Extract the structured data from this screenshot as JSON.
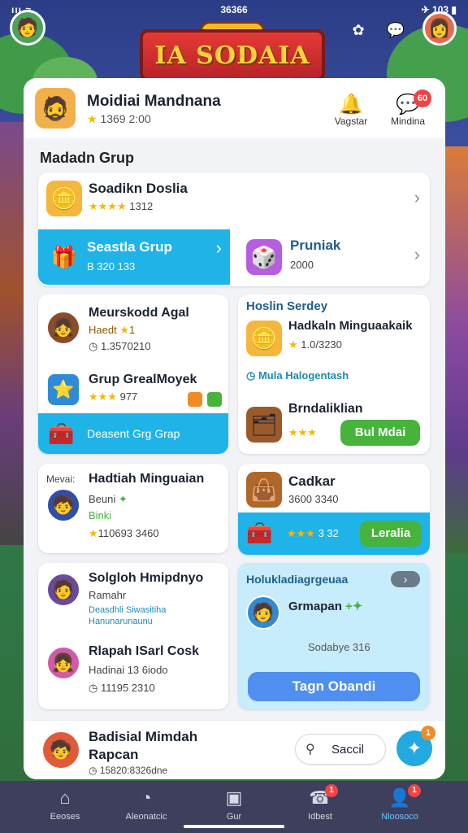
{
  "status": {
    "time": "36366",
    "left": "ııı ≈",
    "right": "✈ 103 ▮"
  },
  "top": {
    "logo": "IA SODAIA"
  },
  "header": {
    "name": "Moidiai Mandnana",
    "rating": "1369 2:00",
    "btn1_label": "Vagstar",
    "btn2_label": "Mindina",
    "btn2_badge": "60"
  },
  "section_title": "Madadn Grup",
  "rows": {
    "r1": {
      "title": "Soadikn Doslia",
      "sub": "1312"
    },
    "r2": {
      "title": "Seastla Grup",
      "sub": "B 320 133"
    },
    "r3": {
      "title": "Pruniak",
      "sub": "2000"
    }
  },
  "left_card1": {
    "title1": "Meurskodd Agal",
    "sub1": "Haedt",
    "val1": "1.3570210",
    "title2": "Grup GrealMoyek",
    "val2": "977",
    "strip": "Deasent Grg Grap"
  },
  "right_card1": {
    "heading": "Hoslin Serdey",
    "title1": "Hadkaln Minguaakaik",
    "sub1": "1.0/3230",
    "link": "Mula Halogentash",
    "title2": "Brndaliklian",
    "btn": "Bul Mdai"
  },
  "left_card2": {
    "prefix": "Mevai:",
    "title": "Hadtiah Minguaian",
    "line2": "Beuni",
    "line3": "Binki",
    "value": "110693 3460"
  },
  "right_card2": {
    "title": "Cadkar",
    "sub": "3600 3340",
    "strip_value": "3 32",
    "btn": "Leralia"
  },
  "left_card3": {
    "title1": "Solgloh Hmipdnyo",
    "sub1": "Ramahr",
    "link1": "Deasdhli Siwasitiha",
    "link2": "Hanunarunaunu",
    "title2": "Rlapah ISarl Cosk",
    "sub2": "Hadinai 13 6iodo",
    "val2": "11195 2310"
  },
  "right_card3": {
    "heading": "Holukladiagrgeuaa",
    "name": "Grmapan",
    "count": "Sodabye 316",
    "btn": "Tagn Obandi"
  },
  "bottom_card": {
    "title": "Badisial Mimdah",
    "sub": "Rapcan",
    "val": "15820:8326dne",
    "search": "Saccil",
    "fab_badge": "1"
  },
  "nav": [
    {
      "label": "Eeoses",
      "icon": "⌂"
    },
    {
      "label": "Aleonatcic",
      "icon": "◔"
    },
    {
      "label": "Gur",
      "icon": "▣"
    },
    {
      "label": "Idbest",
      "icon": "☎",
      "badge": "1"
    },
    {
      "label": "Nloosoco",
      "icon": "👤",
      "badge": "1",
      "active": true
    }
  ]
}
